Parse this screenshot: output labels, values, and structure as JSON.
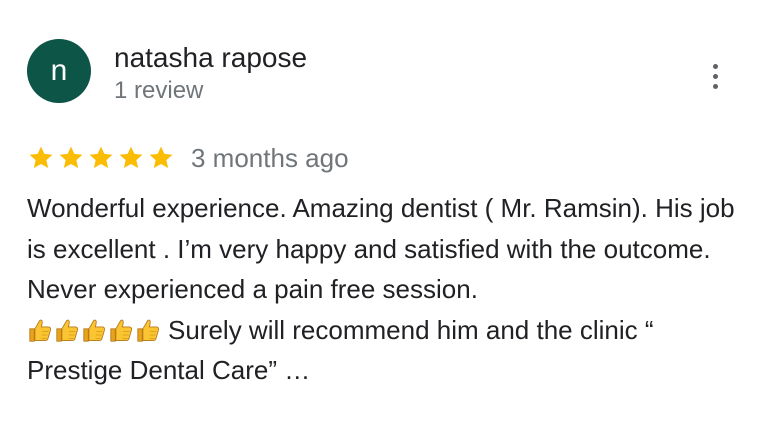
{
  "reviewer": {
    "avatar_initial": "n",
    "avatar_color": "#0d5546",
    "name": "natasha rapose",
    "review_count": "1 review"
  },
  "menu": {
    "icon": "more-vert-icon"
  },
  "rating": {
    "stars": 5,
    "max_stars": 5,
    "star_color": "#fbbc04",
    "date": "3 months ago"
  },
  "review": {
    "text_before_emoji": "Wonderful experience. Amazing dentist ( Mr. Ramsin). His job is excellent . I’m very happy and satisfied with the outcome. Never experienced a pain free session.",
    "emoji": "👍👍👍👍👍",
    "emoji_icon": "thumbs-up-icon",
    "emoji_count": 5,
    "text_after_emoji": "Surely will recommend him and the clinic “ Prestige Dental Care” …"
  }
}
